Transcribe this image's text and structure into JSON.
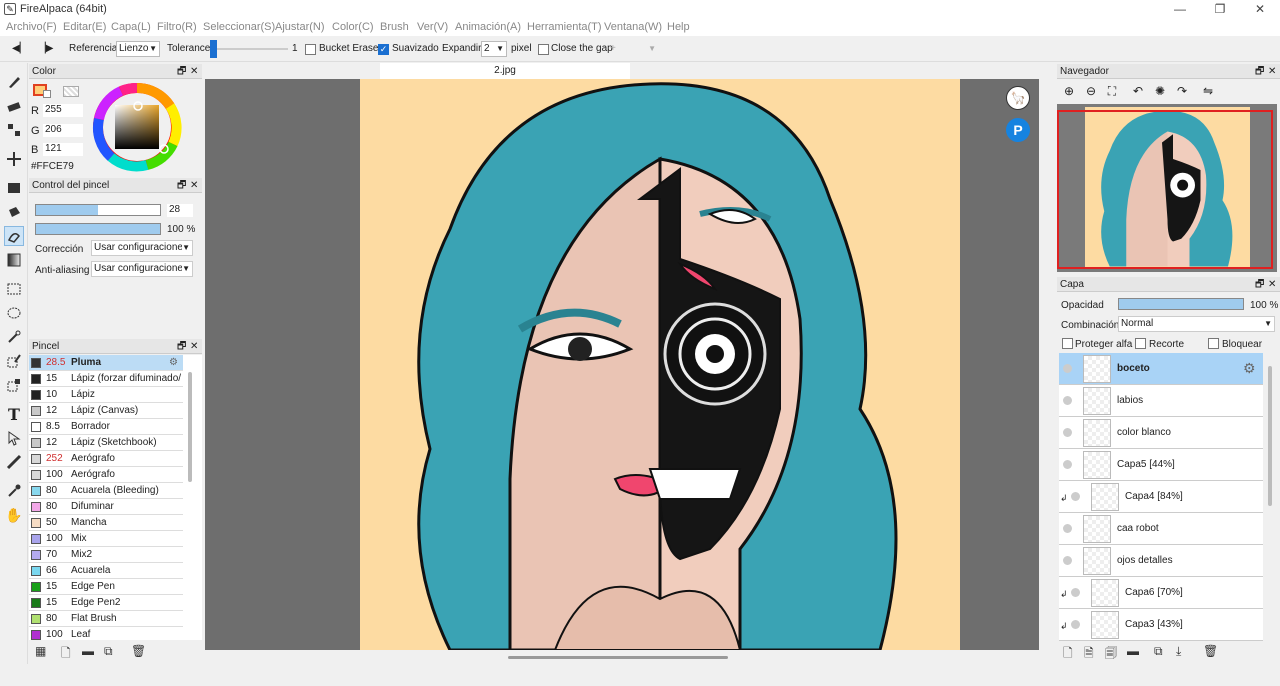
{
  "window": {
    "title": "FireAlpaca (64bit)"
  },
  "menu": [
    "Archivo(F)",
    "Editar(E)",
    "Capa(L)",
    "Filtro(R)",
    "Seleccionar(S)",
    "Ajustar(N)",
    "Color(C)",
    "Brush",
    "Ver(V)",
    "Animación(A)",
    "Herramienta(T)",
    "Ventana(W)",
    "Help"
  ],
  "toolbar": {
    "reference_label": "Referencia",
    "reference_value": "Lienzo",
    "tolerance_label": "Tolerance",
    "tolerance_value": "1",
    "bucket_erase_label": "Bucket Erase",
    "bucket_erase_checked": false,
    "suavizado_label": "Suavizado",
    "suavizado_checked": true,
    "expandir_label": "Expandir",
    "expandir_value": "2",
    "pixel_label": "pixel",
    "close_gap_label": "Close the gap",
    "close_gap_checked": false
  },
  "color_panel": {
    "title": "Color",
    "r_label": "R",
    "r": "255",
    "g_label": "G",
    "g": "206",
    "b_label": "B",
    "b": "121",
    "hex": "#FFCE79",
    "current_color": "#ffce79"
  },
  "brush_control": {
    "title": "Control del pincel",
    "size": "28",
    "size_fraction": 0.5,
    "opacity": "100 %",
    "opacity_fraction": 1.0,
    "correccion_label": "Corrección",
    "correccion_value": "Usar configuraciones",
    "antialias_label": "Anti-aliasing",
    "antialias_value": "Usar configuraciones"
  },
  "brush_panel": {
    "title": "Pincel",
    "items": [
      {
        "size": "28.5",
        "name": "Pluma",
        "color": "#333333",
        "selected": true
      },
      {
        "size": "15",
        "name": "Lápiz (forzar difuminado/a",
        "color": "#222222"
      },
      {
        "size": "10",
        "name": "Lápiz",
        "color": "#222222"
      },
      {
        "size": "12",
        "name": "Lápiz (Canvas)",
        "color": "#c8c8c8"
      },
      {
        "size": "8.5",
        "name": "Borrador",
        "color": "#ffffff"
      },
      {
        "size": "12",
        "name": "Lápiz (Sketchbook)",
        "color": "#c8c8c8"
      },
      {
        "size": "252",
        "name": "Aerógrafo",
        "color": "#d8d8d8",
        "red": true
      },
      {
        "size": "100",
        "name": "Aerógrafo",
        "color": "#d8d8d8"
      },
      {
        "size": "80",
        "name": "Acuarela (Bleeding)",
        "color": "#88d8ee"
      },
      {
        "size": "80",
        "name": "Difuminar",
        "color": "#f2a8e8"
      },
      {
        "size": "50",
        "name": "Mancha",
        "color": "#f6dcc4"
      },
      {
        "size": "100",
        "name": "Mix",
        "color": "#a9a4ec"
      },
      {
        "size": "70",
        "name": "Mix2",
        "color": "#b4aaee"
      },
      {
        "size": "66",
        "name": "Acuarela",
        "color": "#7ad7ef"
      },
      {
        "size": "15",
        "name": "Edge Pen",
        "color": "#1aa01a"
      },
      {
        "size": "15",
        "name": "Edge Pen2",
        "color": "#1a7a1a"
      },
      {
        "size": "80",
        "name": "Flat Brush",
        "color": "#b0e070"
      },
      {
        "size": "100",
        "name": "Leaf",
        "color": "#b030d0"
      }
    ]
  },
  "canvas": {
    "tab": "2.jpg"
  },
  "navigator": {
    "title": "Navegador"
  },
  "layer_panel": {
    "title": "Capa",
    "opacity_label": "Opacidad",
    "opacity": "100 %",
    "blend_label": "Combinación",
    "blend": "Normal",
    "protect_alpha_label": "Proteger alfa",
    "clip_label": "Recorte",
    "lock_label": "Bloquear",
    "layers": [
      {
        "name": "boceto",
        "selected": true,
        "clipped": false
      },
      {
        "name": "labios",
        "clipped": false
      },
      {
        "name": "color blanco",
        "clipped": false
      },
      {
        "name": "Capa5 [44%]",
        "clipped": false
      },
      {
        "name": "Capa4 [84%]",
        "clipped": true
      },
      {
        "name": "caa robot",
        "clipped": false
      },
      {
        "name": "ojos detalles",
        "clipped": false
      },
      {
        "name": "Capa6 [70%]",
        "clipped": true
      },
      {
        "name": "Capa3 [43%]",
        "clipped": true
      }
    ]
  }
}
